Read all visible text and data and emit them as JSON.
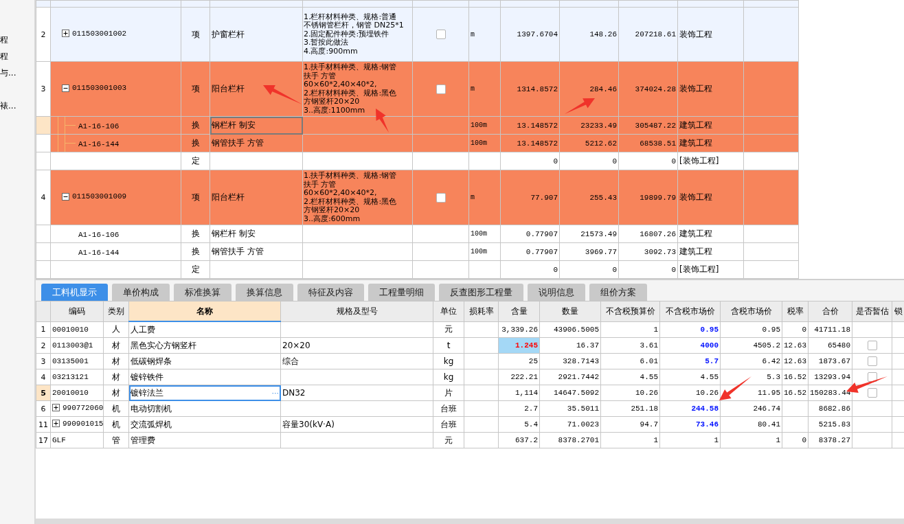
{
  "sidebar": {
    "items": [
      {
        "label": "程"
      },
      {
        "label": "程"
      },
      {
        "label": "与..."
      },
      {
        "label": "裱..."
      }
    ]
  },
  "top_table": {
    "rows": [
      {
        "number": "2",
        "code": "011503001002",
        "type": "项",
        "name": "护窗栏杆",
        "features": [
          "1.栏杆材料种类、规格:普通",
          "不锈钢管栏杆，钢管 DN25*1",
          "2.固定配件种类:预埋铁件",
          "3.暂按此做法",
          "4.高度:900mm"
        ],
        "checked": false,
        "unit": "m",
        "quantity": "1397.6704",
        "unit_price": "148.26",
        "total": "207218.61",
        "category": "装饰工程",
        "highlighted": false,
        "expanded": false,
        "selected": false
      },
      {
        "number": "3",
        "code": "011503001003",
        "type": "项",
        "name": "阳台栏杆",
        "features": [
          "1.扶手材料种类、规格:钢管",
          "扶手 方管",
          "60×60*2,40×40*2,",
          "2.栏杆材料种类、规格:黑色",
          "方钢竖杆20×20",
          "3..高度:1100mm"
        ],
        "checked": false,
        "unit": "m",
        "quantity": "1314.8572",
        "unit_price": "284.46",
        "total": "374024.28",
        "category": "装饰工程",
        "highlighted": true,
        "expanded": true,
        "selected": false,
        "children": [
          {
            "code": "A1-16-106",
            "type": "换",
            "name": "钢栏杆 制安",
            "unit": "100m",
            "quantity": "13.148572",
            "unit_price": "23233.49",
            "total": "305487.22",
            "category": "建筑工程",
            "highlighted": true,
            "selected": true
          },
          {
            "code": "A1-16-144",
            "type": "换",
            "name": "钢管扶手 方管",
            "unit": "100m",
            "quantity": "13.148572",
            "unit_price": "5212.62",
            "total": "68538.51",
            "category": "建筑工程",
            "highlighted": true,
            "selected": false
          },
          {
            "type": "定",
            "quantity": "0",
            "unit_price": "0",
            "total": "0",
            "category": "[装饰工程]",
            "highlighted": false,
            "selected": false
          }
        ]
      },
      {
        "number": "4",
        "code": "011503001009",
        "type": "项",
        "name": "阳台栏杆",
        "features": [
          "1.扶手材料种类、规格:钢管",
          "扶手 方管",
          "60×60*2,40×40*2,",
          "2.栏杆材料种类、规格:黑色",
          "方钢竖杆20×20",
          "3..高度:600mm"
        ],
        "checked": false,
        "unit": "m",
        "quantity": "77.907",
        "unit_price": "255.43",
        "total": "19899.79",
        "category": "装饰工程",
        "highlighted": true,
        "expanded": true,
        "selected": false,
        "children": [
          {
            "code": "A1-16-106",
            "type": "换",
            "name": "钢栏杆 制安",
            "unit": "100m",
            "quantity": "0.77907",
            "unit_price": "21573.49",
            "total": "16807.26",
            "category": "建筑工程",
            "highlighted": false,
            "selected": false
          },
          {
            "code": "A1-16-144",
            "type": "换",
            "name": "钢管扶手 方管",
            "unit": "100m",
            "quantity": "0.77907",
            "unit_price": "3969.77",
            "total": "3092.73",
            "category": "建筑工程",
            "highlighted": false,
            "selected": false
          },
          {
            "type": "定",
            "quantity": "0",
            "unit_price": "0",
            "total": "0",
            "category": "[装饰工程]",
            "highlighted": false,
            "selected": false
          }
        ]
      }
    ]
  },
  "tabs": [
    {
      "label": "工料机显示",
      "selected": true
    },
    {
      "label": "单价构成",
      "selected": false
    },
    {
      "label": "标准换算",
      "selected": false
    },
    {
      "label": "换算信息",
      "selected": false
    },
    {
      "label": "特征及内容",
      "selected": false
    },
    {
      "label": "工程量明细",
      "selected": false
    },
    {
      "label": "反查图形工程量",
      "selected": false
    },
    {
      "label": "说明信息",
      "selected": false
    },
    {
      "label": "组价方案",
      "selected": false
    }
  ],
  "resource_table": {
    "columns": [
      {
        "label": "编码",
        "selected": false
      },
      {
        "label": "类别",
        "selected": false
      },
      {
        "label": "名称",
        "selected": true
      },
      {
        "label": "规格及型号",
        "selected": false
      },
      {
        "label": "单位",
        "selected": false
      },
      {
        "label": "损耗率",
        "selected": false
      },
      {
        "label": "含量",
        "selected": false
      },
      {
        "label": "数量",
        "selected": false
      },
      {
        "label": "不含税预算价",
        "selected": false
      },
      {
        "label": "不含税市场价",
        "selected": false
      },
      {
        "label": "含税市场价",
        "selected": false
      },
      {
        "label": "税率",
        "selected": false
      },
      {
        "label": "合价",
        "selected": false
      },
      {
        "label": "是否暂估",
        "selected": false
      },
      {
        "label": "锁",
        "selected": false
      }
    ],
    "rows": [
      {
        "number": "1",
        "kind": "plain",
        "code": "00010010",
        "type": "人",
        "name": "人工费",
        "unit": "元",
        "content": "3,339.26",
        "content_modified": false,
        "quantity": "43906.5005",
        "budget_price": "1",
        "market_price": "0.95",
        "market_price_changed": true,
        "tax_price": "0.95",
        "tax_rate": "0",
        "total": "41711.18",
        "selected": false
      },
      {
        "number": "2",
        "kind": "plain",
        "code": "0113003@1",
        "type": "材",
        "name": "黑色实心方钢竖杆",
        "spec": "20×20",
        "unit": "t",
        "content": "1.245",
        "content_modified": true,
        "quantity": "16.37",
        "budget_price": "3.61",
        "market_price": "4000",
        "market_price_changed": true,
        "tax_price": "4505.2",
        "tax_rate": "12.63",
        "total": "65480",
        "estimated": false,
        "selected": false
      },
      {
        "number": "3",
        "kind": "plain",
        "code": "03135001",
        "type": "材",
        "name": "低碳钢焊条",
        "spec": "综合",
        "unit": "kg",
        "content": "25",
        "content_modified": false,
        "quantity": "328.7143",
        "budget_price": "6.01",
        "market_price": "5.7",
        "market_price_changed": true,
        "tax_price": "6.42",
        "tax_rate": "12.63",
        "total": "1873.67",
        "estimated": false,
        "selected": false
      },
      {
        "number": "4",
        "kind": "plain",
        "code": "03213121",
        "type": "材",
        "name": "镀锌铁件",
        "unit": "kg",
        "content": "222.21",
        "content_modified": false,
        "quantity": "2921.7442",
        "budget_price": "4.55",
        "market_price": "4.55",
        "market_price_changed": false,
        "tax_price": "5.3",
        "tax_rate": "16.52",
        "total": "13293.94",
        "estimated": false,
        "selected": false
      },
      {
        "number": "5",
        "kind": "plain",
        "code": "20010010",
        "type": "材",
        "name": "镀锌法兰",
        "spec": "DN32",
        "unit": "片",
        "content": "1,114",
        "content_modified": false,
        "quantity": "14647.5092",
        "budget_price": "10.26",
        "market_price": "10.26",
        "market_price_changed": false,
        "tax_price": "11.95",
        "tax_rate": "16.52",
        "total": "150283.44",
        "estimated": false,
        "selected": true,
        "ellipsis": "···"
      },
      {
        "number": "6",
        "kind": "group",
        "code": "990772060",
        "type": "机",
        "name": "电动切割机",
        "unit": "台班",
        "content": "2.7",
        "content_modified": false,
        "quantity": "35.5011",
        "budget_price": "251.18",
        "market_price": "244.58",
        "market_price_changed": true,
        "tax_price": "246.74",
        "total": "8682.86",
        "selected": false
      },
      {
        "number": "11",
        "kind": "group",
        "code": "990901015",
        "type": "机",
        "name": "交流弧焊机",
        "spec": "容量30(kV·A)",
        "unit": "台班",
        "content": "5.4",
        "content_modified": false,
        "quantity": "71.0023",
        "budget_price": "94.7",
        "market_price": "73.46",
        "market_price_changed": true,
        "tax_price": "80.41",
        "total": "5215.83",
        "selected": false
      },
      {
        "number": "17",
        "kind": "plain",
        "code": "GLF",
        "type": "管",
        "name": "管理费",
        "unit": "元",
        "content": "637.2",
        "content_modified": false,
        "quantity": "8378.2701",
        "budget_price": "1",
        "market_price": "1",
        "market_price_changed": false,
        "tax_price": "1",
        "tax_rate": "0",
        "total": "8378.27",
        "selected": false
      }
    ]
  }
}
